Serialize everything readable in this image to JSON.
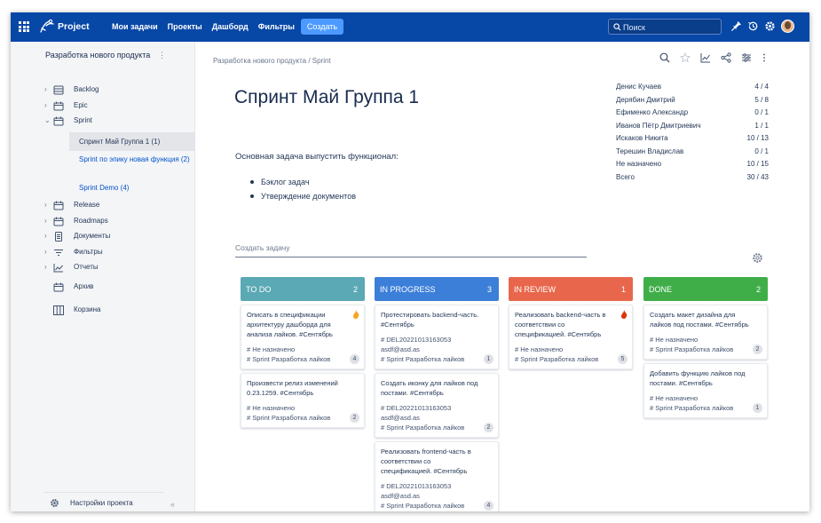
{
  "topbar": {
    "brand": "Project",
    "nav": [
      "Мои задачи",
      "Проекты",
      "Дашборд",
      "Фильтры"
    ],
    "create_label": "Создать",
    "search_placeholder": "Поиск",
    "bg_color": "#0747a6"
  },
  "sidebar": {
    "project_title": "Разработка нового продукта",
    "more_label": "⋮",
    "items": [
      {
        "label": "Backlog",
        "icon": "backlog-icon"
      },
      {
        "label": "Epic",
        "icon": "calendar-icon"
      },
      {
        "label": "Sprint",
        "icon": "calendar-icon"
      },
      {
        "label": "Release",
        "icon": "calendar-icon"
      },
      {
        "label": "Roadmaps",
        "icon": "calendar-icon"
      },
      {
        "label": "Документы",
        "icon": "document-icon"
      },
      {
        "label": "Фильтры",
        "icon": "filter-icon"
      },
      {
        "label": "Отчеты",
        "icon": "chart-icon"
      },
      {
        "label": "Архив",
        "icon": "calendar-icon"
      },
      {
        "label": "Корзина",
        "icon": "columns-icon"
      }
    ],
    "sprints": [
      {
        "label": "Спринт Май Группа 1 (1)",
        "active": true
      },
      {
        "label": "Sprint по эпику новая функция (2)",
        "active": false
      },
      {
        "label": "Sprint Demo (4)",
        "active": false
      }
    ],
    "footer_label": "Настройки проекта",
    "collapse_label": "«"
  },
  "main": {
    "breadcrumb": "Разработка нового продукта / Sprint",
    "title": "Спринт Май Группа 1",
    "description": "Основная задача выпустить функционал:",
    "bullets": [
      "Бэклог задач",
      "Утверждение документов"
    ],
    "create_task_placeholder": "Создать задачу"
  },
  "stats": [
    {
      "name": "Денис Кучаев",
      "value": "4 / 4"
    },
    {
      "name": "Дерябин Дмитрий",
      "value": "5 / 8"
    },
    {
      "name": "Ефименко Александр",
      "value": "0 / 1"
    },
    {
      "name": "Иванов Пётр Дмитриевич",
      "value": "1 / 1"
    },
    {
      "name": "Искаков Никита",
      "value": "10 / 13"
    },
    {
      "name": "Терешин Владислав",
      "value": "0 / 1"
    },
    {
      "name": "Не назначено",
      "value": "10 / 15"
    },
    {
      "name": "Всего",
      "value": "30 / 43"
    }
  ],
  "board": {
    "columns": [
      {
        "name": "TO DO",
        "count": "2",
        "color": "#5aa9b4",
        "cards": [
          {
            "title": "Описать в спецификации архитектуру дашборда для анализа лайков. #Сентябрь",
            "fire": "orange",
            "lines": [
              "# Не назначено",
              "# Sprint Разработка лайков"
            ],
            "count": "4"
          },
          {
            "title": "Произвести релиз изменений 0.23.1259. #Сентябрь",
            "fire": "",
            "lines": [
              "# Не назначено",
              "# Sprint Разработка лайков"
            ],
            "count": "2"
          }
        ]
      },
      {
        "name": "IN PROGRESS",
        "count": "3",
        "color": "#3c7fd8",
        "cards": [
          {
            "title": "Протестировать backend-часть. #Сентябрь",
            "fire": "",
            "lines": [
              "# DEL20221013163053",
              "asdf@asd.as",
              "# Sprint Разработка лайков"
            ],
            "count": "1"
          },
          {
            "title": "Создать иконку для лайков под постами. #Сентябрь",
            "fire": "",
            "lines": [
              "# DEL20221013163053",
              "asdf@asd.as",
              "# Sprint Разработка лайков"
            ],
            "count": "2"
          },
          {
            "title": "Реализовать frontend-часть в соответствии со спецификацией. #Сентябрь",
            "fire": "",
            "lines": [
              "# DEL20221013163053",
              "asdf@asd.as",
              "# Sprint Разработка лайков"
            ],
            "count": "4"
          }
        ]
      },
      {
        "name": "IN REVIEW",
        "count": "1",
        "color": "#e8674c",
        "cards": [
          {
            "title": "Реализовать backend-часть в соответствии со спецификацией. #Сентябрь",
            "fire": "red",
            "lines": [
              "# Не назначено",
              "# Sprint Разработка лайков"
            ],
            "count": "5"
          }
        ]
      },
      {
        "name": "DONE",
        "count": "2",
        "color": "#3fae49",
        "cards": [
          {
            "title": "Создать макет дизайна для лайков под постами. #Сентябрь",
            "fire": "",
            "lines": [
              "# Не назначено",
              "# Sprint Разработка лайков"
            ],
            "count": "2"
          },
          {
            "title": "Добавить функцию лайков под постами. #Сентябрь",
            "fire": "",
            "lines": [
              "# Не назначено",
              "# Sprint Разработка лайков"
            ],
            "count": "1"
          }
        ]
      }
    ]
  }
}
